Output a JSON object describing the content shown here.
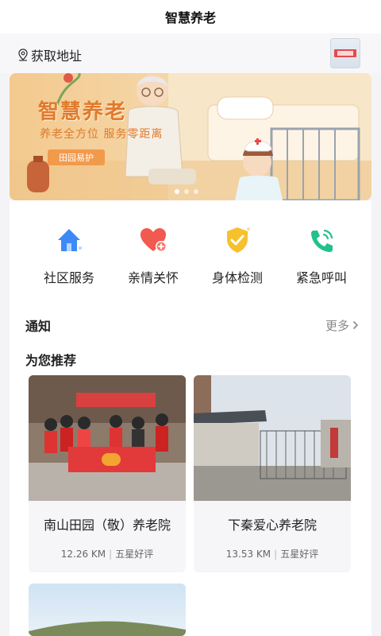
{
  "app": {
    "title": "智慧养老"
  },
  "location": {
    "label": "获取地址"
  },
  "banner": {
    "title": "智慧养老",
    "subtitle": "养老全方位  服务零距离",
    "button": "田园易护"
  },
  "quick_actions": [
    {
      "label": "社区服务",
      "icon": "home-icon",
      "color": "#3d8af7"
    },
    {
      "label": "亲情关怀",
      "icon": "heart-plus-icon",
      "color": "#f05a4f"
    },
    {
      "label": "身体检测",
      "icon": "shield-check-icon",
      "color": "#f6c12d"
    },
    {
      "label": "紧急呼叫",
      "icon": "phone-call-icon",
      "color": "#22c18a"
    }
  ],
  "notice": {
    "title": "通知",
    "more": "更多"
  },
  "recommend": {
    "title": "为您推荐",
    "items": [
      {
        "name": "南山田园（敬）养老院",
        "distance": "12.26 KM",
        "rating": "五星好评"
      },
      {
        "name": "下秦爱心养老院",
        "distance": "13.53 KM",
        "rating": "五星好评"
      },
      {
        "name": "",
        "distance": "",
        "rating": ""
      }
    ]
  },
  "colors": {
    "accent": "#e07a2c",
    "background": "#f4f4f6"
  }
}
